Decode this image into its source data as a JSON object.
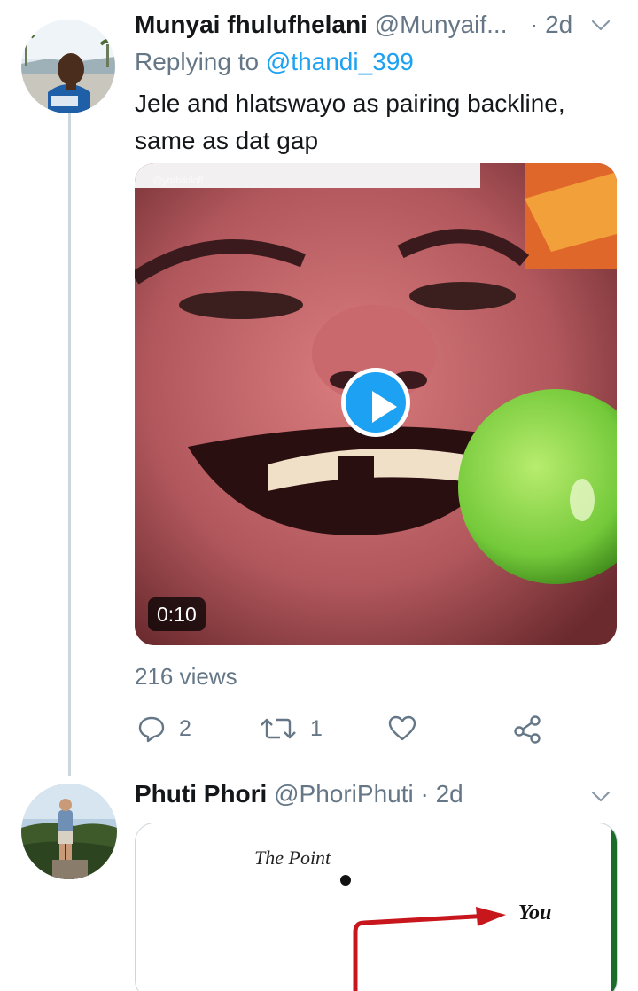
{
  "tweets": [
    {
      "name": "Munyai fhulufhelani",
      "handle": "@Munyaif...",
      "separator": "·",
      "time": "2d",
      "replying_prefix": "Replying to",
      "replying_to": "@thandi_399",
      "text": "Jele and hlatswayo as pairing backline, same as dat gap",
      "media": {
        "type": "video",
        "duration": "0:10",
        "watermark": "@yorbikiloff"
      },
      "views": "216 views",
      "actions": {
        "reply_count": "2",
        "retweet_count": "1"
      },
      "icons": [
        "reply-icon",
        "retweet-icon",
        "like-icon",
        "share-icon",
        "chevron-down-icon",
        "play-icon"
      ]
    },
    {
      "name": "Phuti Phori",
      "handle": "@PhoriPhuti",
      "separator": "·",
      "time": "2d",
      "card": {
        "label_point": "The Point",
        "label_you": "You"
      }
    }
  ],
  "colors": {
    "accent": "#1da1f2",
    "secondary_text": "#657786",
    "primary_text": "#14171a",
    "thread_line": "#ccd6dd"
  }
}
